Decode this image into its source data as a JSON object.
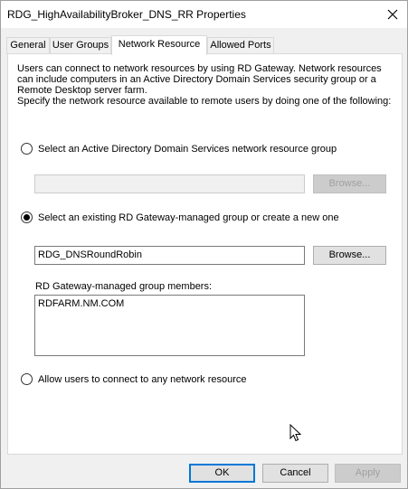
{
  "window": {
    "title": "RDG_HighAvailabilityBroker_DNS_RR Properties"
  },
  "tabs": [
    {
      "label": "General"
    },
    {
      "label": "User Groups"
    },
    {
      "label": "Network Resource"
    },
    {
      "label": "Allowed Ports"
    }
  ],
  "panel": {
    "description_line1": "Users can connect to network resources by using RD Gateway. Network resources",
    "description_line2": "can include computers in an Active Directory Domain Services security group or a",
    "description_line3": "Remote Desktop server farm.",
    "description_line4": "Specify the network resource available to remote users by doing one of the following:",
    "option1": {
      "label": "Select an Active Directory Domain Services network resource group",
      "checked": false,
      "value": "",
      "browse_label": "Browse..."
    },
    "option2": {
      "label": "Select an existing RD Gateway-managed group or create a new one",
      "checked": true,
      "value": "RDG_DNSRoundRobin",
      "browse_label": "Browse...",
      "members_label": "RD Gateway-managed group members:",
      "members": [
        "RDFARM.NM.COM"
      ]
    },
    "option3": {
      "label": "Allow users to connect to any network resource",
      "checked": false
    }
  },
  "buttons": {
    "ok": "OK",
    "cancel": "Cancel",
    "apply": "Apply"
  }
}
